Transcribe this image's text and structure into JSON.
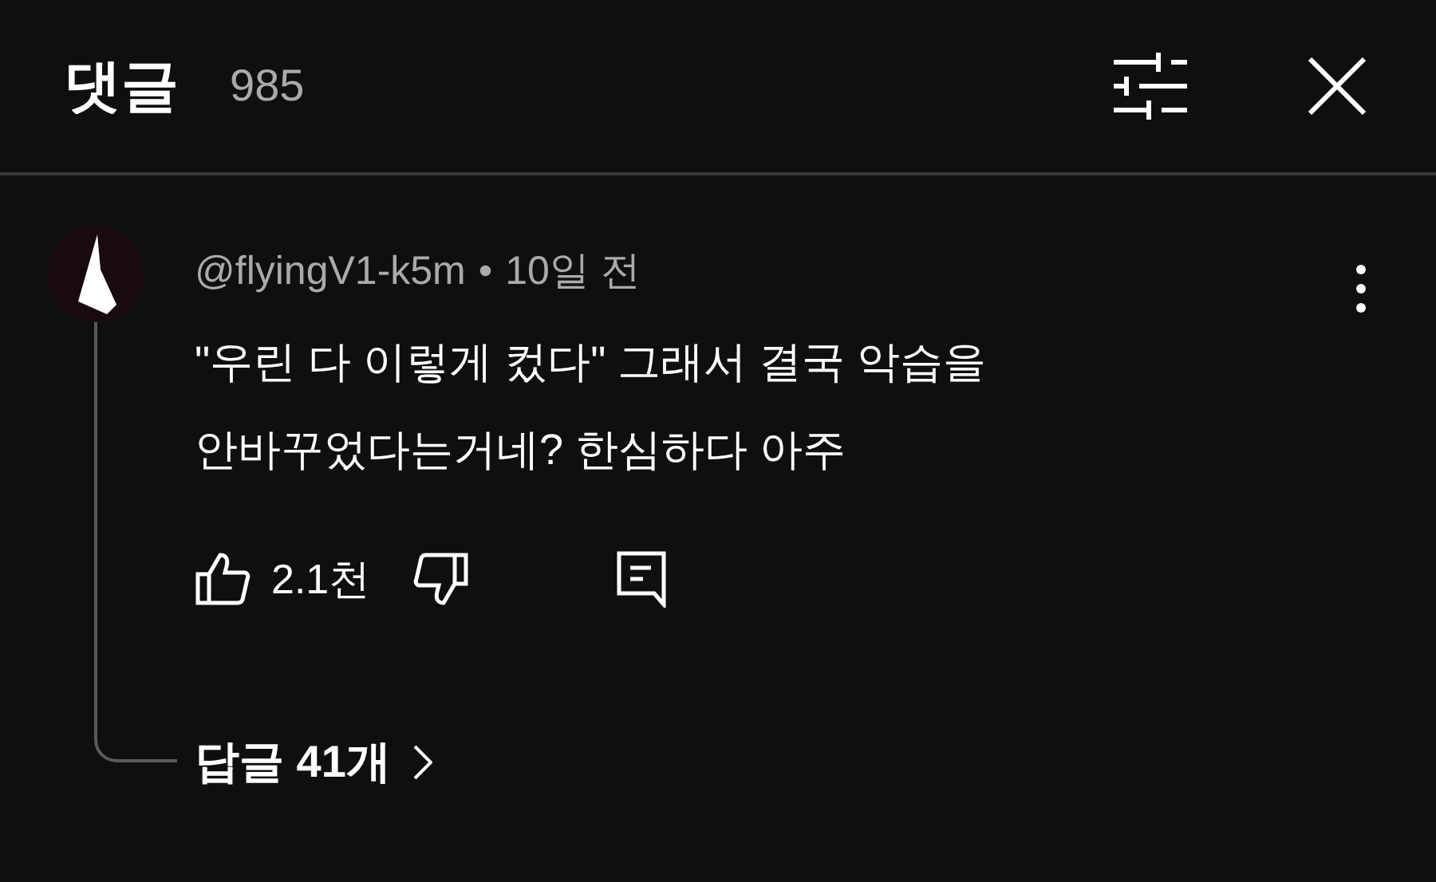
{
  "header": {
    "title": "댓글",
    "count": "985"
  },
  "comment": {
    "author": "@flyingV1-k5m",
    "separator": "•",
    "time": "10일 전",
    "lines": [
      "\"우린 다 이렇게 컸다\" 그래서 결국 악습을",
      "안바꾸었다는거네? 한심하다 아주"
    ],
    "likes": "2.1천",
    "replies": "답글 41개"
  }
}
